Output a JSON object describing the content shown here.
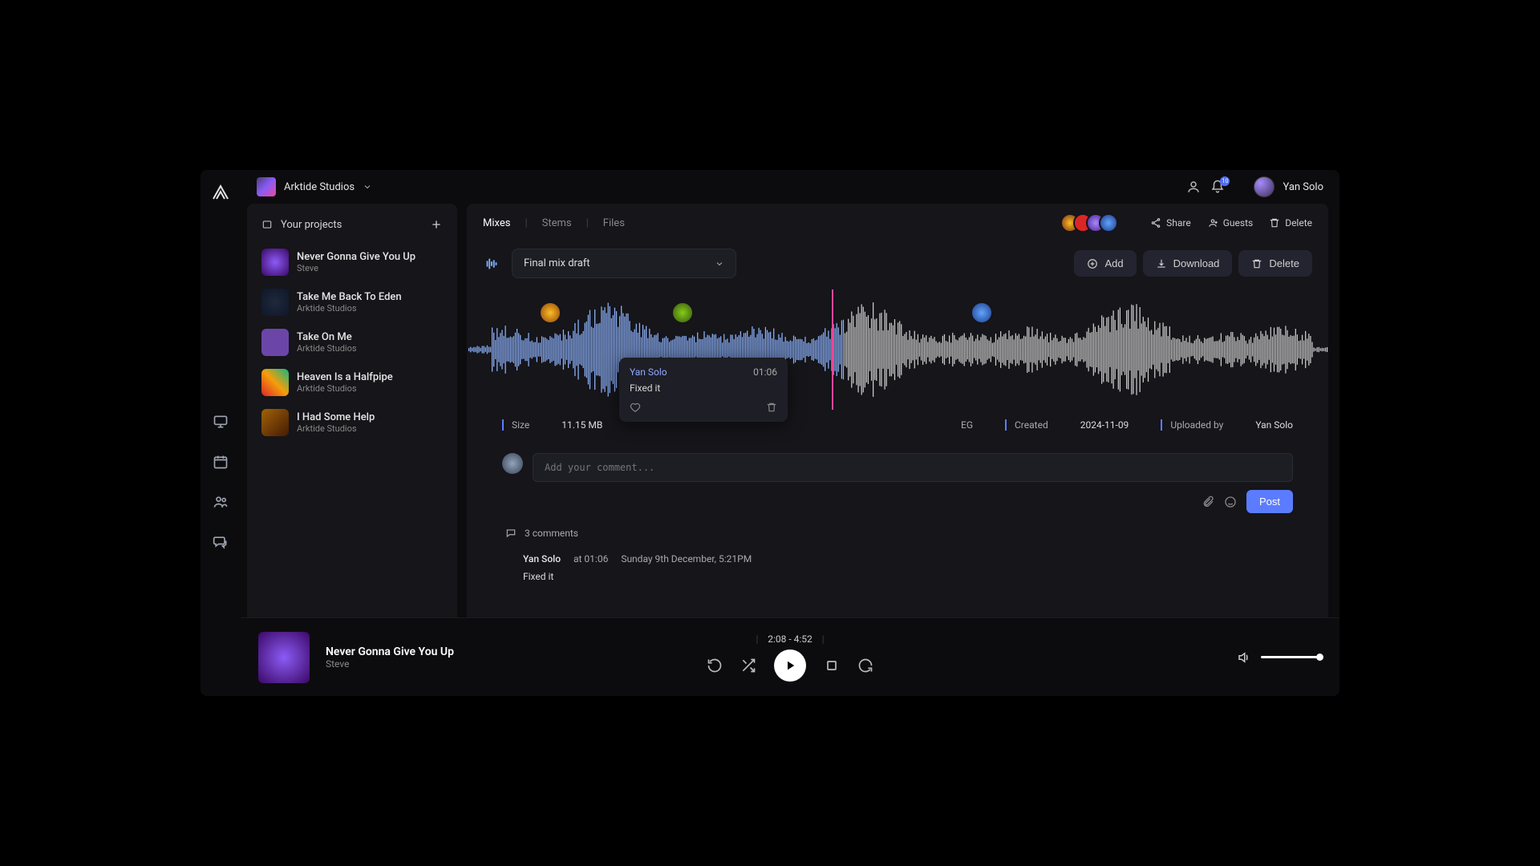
{
  "workspace": {
    "name": "Arktide Studios"
  },
  "user": {
    "name": "Yan Solo",
    "notification_count": "10"
  },
  "sidebar": {
    "header": "Your projects",
    "items": [
      {
        "title": "Never Gonna Give You Up",
        "subtitle": "Steve"
      },
      {
        "title": "Take Me Back To Eden",
        "subtitle": "Arktide Studios"
      },
      {
        "title": "Take On Me",
        "subtitle": "Arktide Studios"
      },
      {
        "title": "Heaven Is a Halfpipe",
        "subtitle": "Arktide Studios"
      },
      {
        "title": "I Had Some Help",
        "subtitle": "Arktide Studios"
      }
    ]
  },
  "detail": {
    "tabs": {
      "mixes": "Mixes",
      "stems": "Stems",
      "files": "Files"
    },
    "actions": {
      "share": "Share",
      "guests": "Guests",
      "delete": "Delete"
    },
    "mix_select": "Final mix draft",
    "mix_buttons": {
      "add": "Add",
      "download": "Download",
      "delete": "Delete"
    },
    "meta": {
      "size_label": "Size",
      "size_val": "11.15 MB",
      "fmt_val": "EG",
      "created_label": "Created",
      "created_val": "2024-11-09",
      "uploaded_label": "Uploaded by",
      "uploaded_val": "Yan Solo"
    },
    "popup": {
      "author": "Yan Solo",
      "time": "01:06",
      "body": "Fixed it"
    },
    "comment_placeholder": "Add your comment...",
    "post_label": "Post",
    "comments_count": "3 comments",
    "comment1": {
      "author": "Yan Solo",
      "at": "at 01:06",
      "date": "Sunday 9th December, 5:21PM",
      "body": "Fixed it"
    }
  },
  "player": {
    "title": "Never Gonna Give You Up",
    "artist": "Steve",
    "time": "2:08 - 4:52"
  }
}
